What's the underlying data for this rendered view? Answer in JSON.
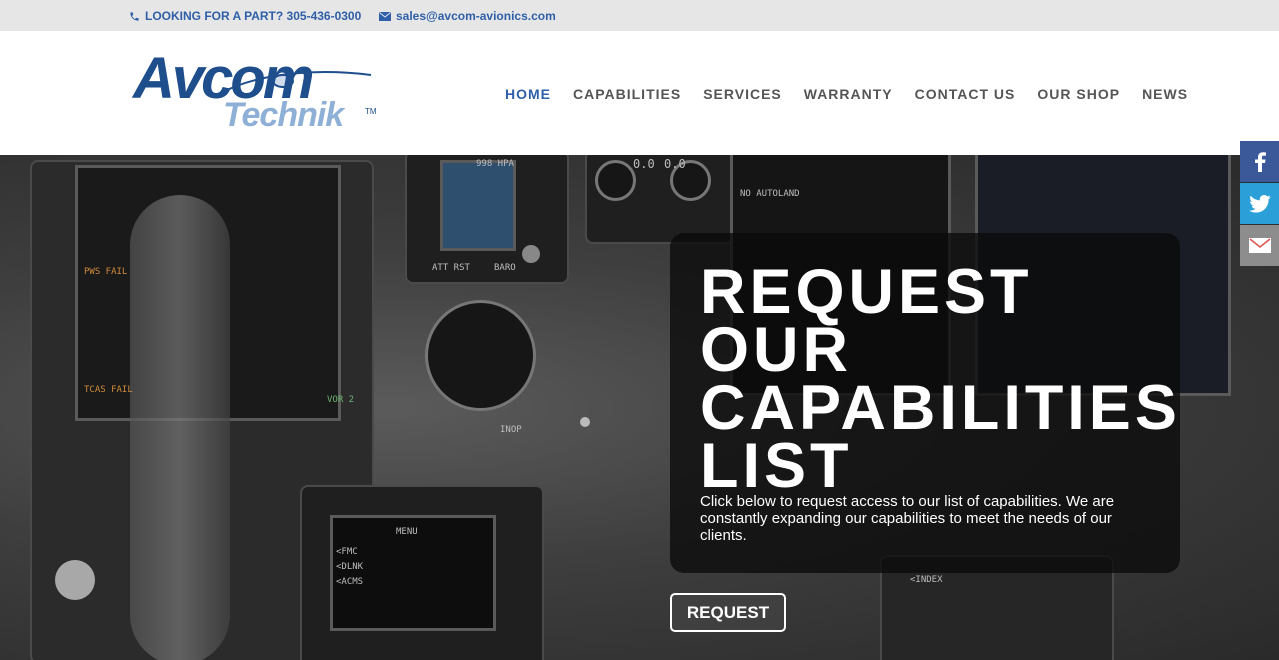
{
  "topbar": {
    "phone_text": "LOOKING FOR A PART? 305-436-0300",
    "email_text": "sales@avcom-avionics.com",
    "icons": [
      "phone-icon",
      "mail-icon"
    ]
  },
  "logo": {
    "brand": "Avcom",
    "sub": "Technik",
    "tm": "TM"
  },
  "nav": {
    "items": [
      {
        "label": "HOME",
        "active": true
      },
      {
        "label": "CAPABILITIES"
      },
      {
        "label": "SERVICES"
      },
      {
        "label": "WARRANTY"
      },
      {
        "label": "CONTACT US"
      },
      {
        "label": "OUR SHOP"
      },
      {
        "label": "NEWS"
      }
    ],
    "active_color": "#2e5fa8"
  },
  "hero": {
    "title_lines": [
      "REQUEST",
      "OUR",
      "CAPABILITIES",
      "LIST"
    ],
    "description": "Click below to request access to our list of capabilities. We are constantly expanding our capabilities to meet the needs of our clients.",
    "button_label": "REQUEST",
    "cockpit_text": [
      "998 HPA",
      "0.0",
      "0.0",
      "NO AUTOLAND",
      "VOR 2",
      "MENU",
      "<FMC",
      "<DLNK",
      "<ACMS",
      "<INDEX",
      "TCAS FAIL",
      "PWS FAIL",
      "ATT RST",
      "BARO",
      "INOP"
    ]
  },
  "social": {
    "items": [
      "facebook-icon",
      "twitter-icon",
      "email-icon"
    ],
    "colors": {
      "facebook": "#3b5998",
      "twitter": "#2b9fd8",
      "email": "#8d8d8d"
    }
  }
}
